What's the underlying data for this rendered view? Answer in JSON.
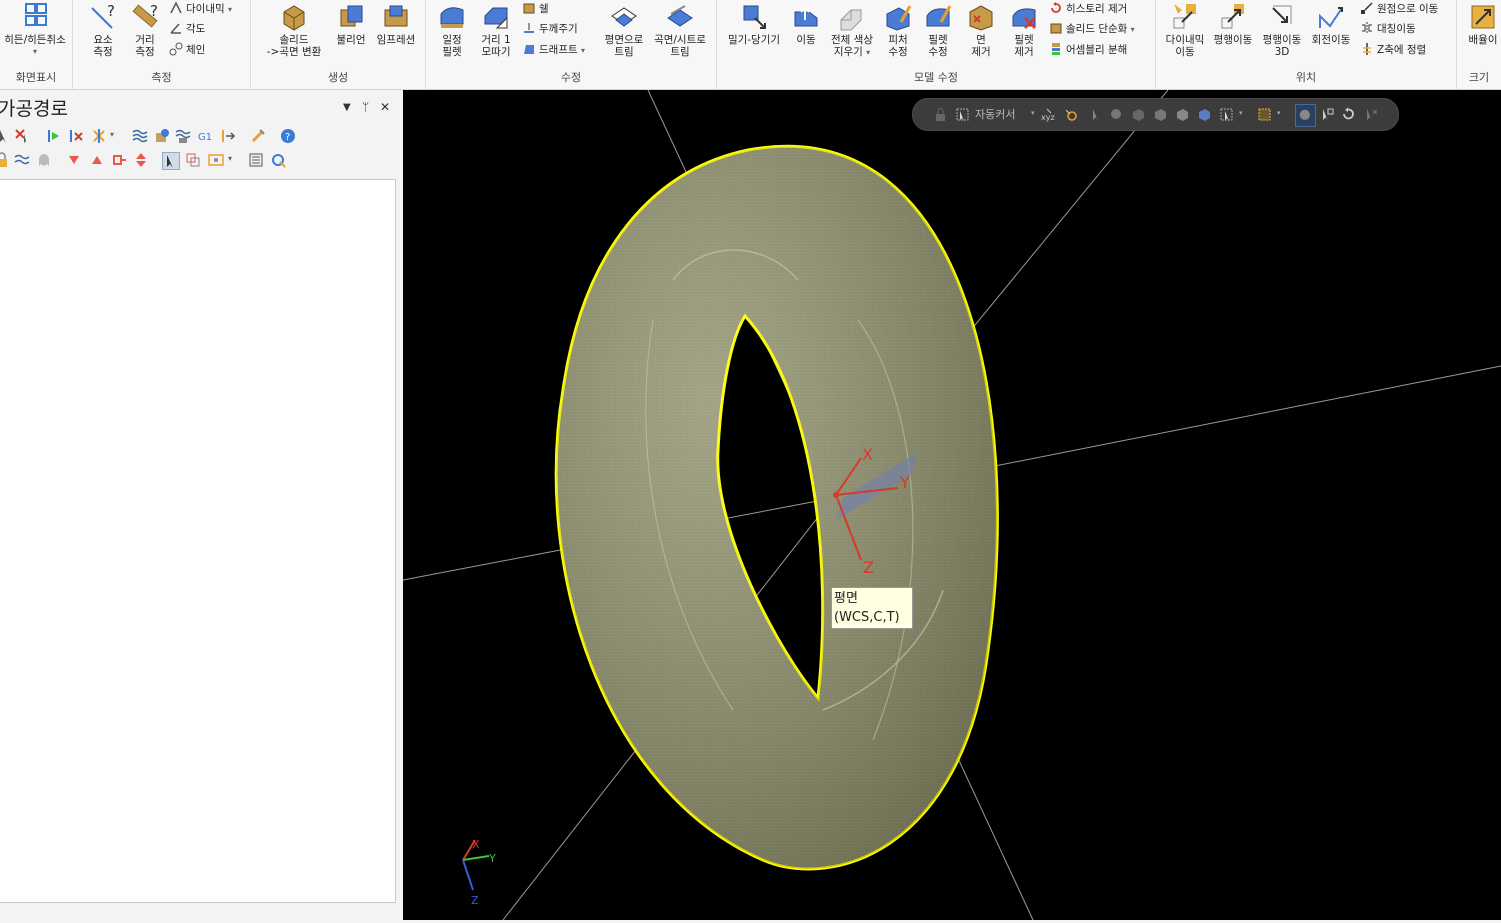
{
  "ribbon": {
    "groups": {
      "display": {
        "label": "화면표시",
        "hide_show": "히든/히든취소"
      },
      "measure": {
        "label": "측정",
        "element": "요소\n측정",
        "distance": "거리\n측정",
        "dynamic": "다이내믹",
        "angle": "각도",
        "chain": "체인"
      },
      "create": {
        "label": "생성",
        "solid_to_surface": "솔리드\n->곡면 변환",
        "boolean": "불리언",
        "impression": "임프레션"
      },
      "modify": {
        "label": "수정",
        "const_fillet": "일정\n필렛",
        "dist_chamfer": "거리 1\n모따기",
        "shell": "쉘",
        "thicken": "두께주기",
        "draft": "드래프트",
        "trim_plane": "평면으로\n트림",
        "trim_surface": "곡면/시트로\n트림"
      },
      "model_modify": {
        "label": "모델 수정",
        "push_pull": "밀기-당기기",
        "move": "이동",
        "erase_color": "전체 색상\n지우기",
        "feature_modify": "피처\n수정",
        "fillet_modify": "필렛\n수정",
        "face_remove": "면\n제거",
        "fillet_remove": "필렛\n제거",
        "history_remove": "히스토리 제거",
        "solid_simplify": "솔리드 단순화",
        "assembly_split": "어셈블리 분해"
      },
      "position": {
        "label": "위치",
        "dynamic_move": "다이내믹\n이동",
        "translate": "평행이동",
        "translate3d": "평행이동\n3D",
        "rotate": "회전이동",
        "to_origin": "원점으로 이동",
        "mirror": "대칭이동",
        "align_z": "Z축에 정렬"
      },
      "size": {
        "label": "크기",
        "scale": "배율이"
      }
    }
  },
  "left_panel": {
    "title": "가공경로",
    "pin": "ᛘ",
    "close": "✕",
    "dropdown": "▼"
  },
  "viewport": {
    "toolbar_label": "자동커서",
    "tooltip_line1": "평면",
    "tooltip_line2": "(WCS,C,T)",
    "axis_x": "X",
    "axis_y": "Y",
    "axis_z": "Z",
    "triad_x": "X",
    "triad_y": "Y",
    "triad_z": "Z"
  },
  "colors": {
    "highlight": "#ffff00",
    "model_fill": "#8a8a62",
    "axis_x": "#d63a2a",
    "axis_y": "#3ac43a",
    "axis_z": "#3a5ad6"
  }
}
